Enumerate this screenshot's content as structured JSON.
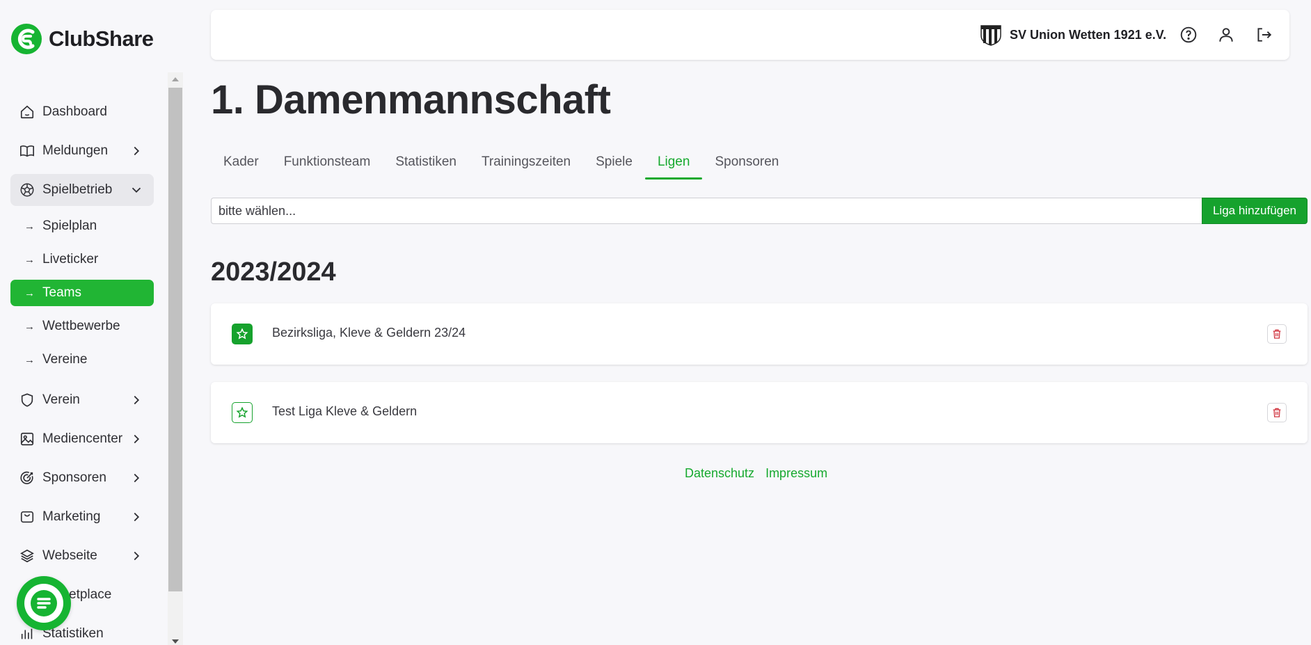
{
  "brand": {
    "name": "ClubShare",
    "accent": "#16a92e"
  },
  "sidebar": {
    "items": [
      {
        "label": "Dashboard",
        "icon": "home-icon",
        "expandable": false
      },
      {
        "label": "Meldungen",
        "icon": "book-icon",
        "expandable": true
      },
      {
        "label": "Spielbetrieb",
        "icon": "soccer-ball-icon",
        "expandable": true,
        "open": true
      },
      {
        "label": "Verein",
        "icon": "shield-icon",
        "expandable": true
      },
      {
        "label": "Mediencenter",
        "icon": "image-icon",
        "expandable": true
      },
      {
        "label": "Sponsoren",
        "icon": "target-icon",
        "expandable": true
      },
      {
        "label": "Marketing",
        "icon": "bag-icon",
        "expandable": true
      },
      {
        "label": "Webseite",
        "icon": "layers-icon",
        "expandable": true
      },
      {
        "label": "etplace",
        "icon": "store-icon",
        "expandable": false
      },
      {
        "label": "Statistiken",
        "icon": "chart-icon",
        "expandable": false
      }
    ],
    "sub_items": [
      {
        "label": "Spielplan"
      },
      {
        "label": "Liveticker"
      },
      {
        "label": "Teams",
        "active": true
      },
      {
        "label": "Wettbewerbe"
      },
      {
        "label": "Vereine"
      }
    ]
  },
  "header": {
    "club_name": "SV Union Wetten 1921 e.V.",
    "icons": [
      "help-icon",
      "user-icon",
      "logout-icon"
    ]
  },
  "main": {
    "title": "1. Damenmannschaft",
    "tabs": [
      {
        "label": "Kader"
      },
      {
        "label": "Funktionsteam"
      },
      {
        "label": "Statistiken"
      },
      {
        "label": "Trainingszeiten"
      },
      {
        "label": "Spiele"
      },
      {
        "label": "Ligen",
        "active": true
      },
      {
        "label": "Sponsoren"
      }
    ],
    "league_select": {
      "value": "bitte wählen..."
    },
    "add_button": "Liga hinzufügen",
    "season": "2023/2024",
    "leagues": [
      {
        "name": "Bezirksliga, Kleve & Geldern 23/24",
        "primary": true
      },
      {
        "name": "Test Liga Kleve & Geldern",
        "primary": false
      }
    ]
  },
  "footer": {
    "links": [
      "Datenschutz",
      "Impressum"
    ]
  }
}
